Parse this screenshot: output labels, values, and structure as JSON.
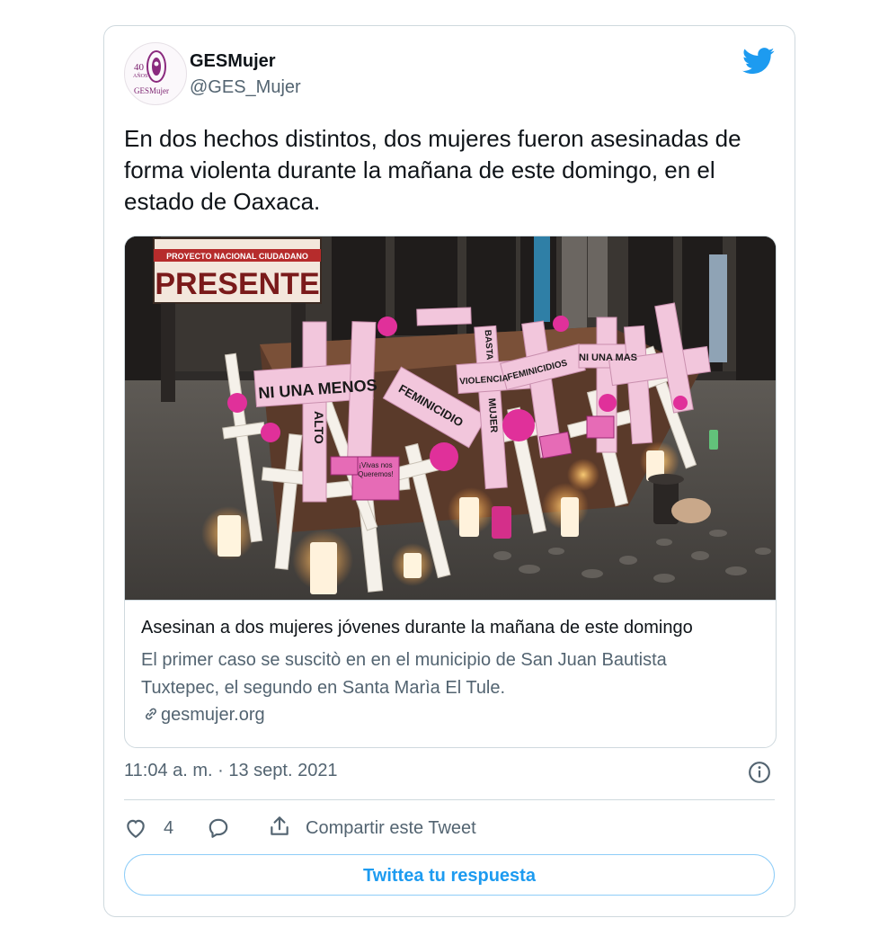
{
  "tweet": {
    "author": {
      "name": "GESMujer",
      "handle": "@GES_Mujer",
      "avatar_logo": {
        "number": "40",
        "years": "AÑOS",
        "brand": "GESMujer"
      }
    },
    "text": "En dos hechos distintos, dos mujeres fueron asesinadas de forma violenta durante la mañana de este domingo, en el estado de Oaxaca.",
    "link_card": {
      "image_signs": {
        "banner_top": "PROYECTO NACIONAL CIUDADANO",
        "banner_main": "PRESENTE",
        "cross_main": "NI UNA MENOS",
        "cross_alto": "ALTO",
        "cross_feminicidio": "FEMINICIDIO",
        "cross_basta": "BASTA",
        "cross_violencia": "VIOLENCIA",
        "cross_mujer": "MUJER",
        "cross_feminicidios": "FEMINICIDIOS",
        "cross_ni_una_mas": "NI UNA MAS",
        "placard": "¡Vivas nos Queremos!"
      },
      "title": "Asesinan a dos mujeres jóvenes durante la mañana de este domingo",
      "description": "El primer caso se suscitò en en el municipio de San Juan Bautista Tuxtepec, el segundo en Santa Marìa El Tule.",
      "domain": "gesmujer.org"
    },
    "timestamp": "11:04 a. m. · 13 sept. 2021",
    "likes": "4",
    "share_label": "Compartir este Tweet",
    "reply_button": "Twittea tu respuesta",
    "icons": {
      "brand": "twitter-bird-icon",
      "like": "heart-icon",
      "reply": "reply-bubble-icon",
      "share": "share-upload-icon",
      "info": "info-icon",
      "link": "link-icon"
    },
    "colors": {
      "accent": "#1d9bf0",
      "text_primary": "#0f1419",
      "text_secondary": "#536471",
      "border": "#cfd9de",
      "sign_pink": "#f2c6dc",
      "flower_magenta": "#e0309a"
    }
  }
}
